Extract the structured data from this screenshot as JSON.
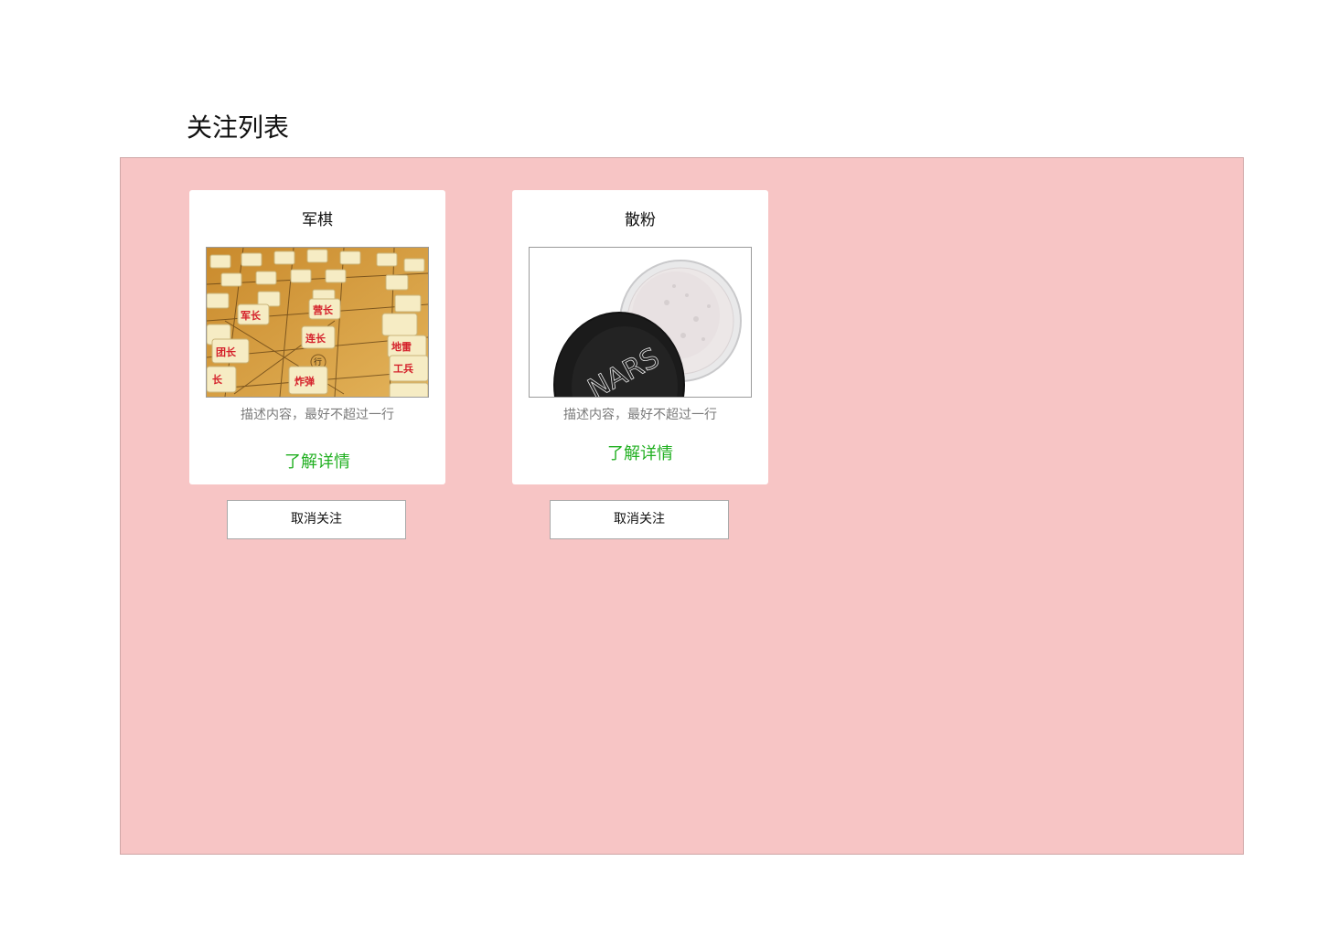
{
  "page": {
    "title": "关注列表"
  },
  "items": [
    {
      "title": "军棋",
      "image": "junqi-chess-board-photo",
      "description": "描述内容，最好不超过一行",
      "link_label": "了解详情",
      "unfollow_label": "取消关注",
      "piece_labels": [
        "军长",
        "营长",
        "连长",
        "团长",
        "炸弹",
        "工兵",
        "地雷",
        "行",
        "长"
      ]
    },
    {
      "title": "散粉",
      "image": "nars-loose-powder-photo",
      "description": "描述内容，最好不超过一行",
      "link_label": "了解详情",
      "unfollow_label": "取消关注",
      "brand_text": "NARS"
    }
  ],
  "colors": {
    "panel_background": "#f7c5c5",
    "link_green": "#22b022",
    "description_gray": "#7a7a7a"
  }
}
